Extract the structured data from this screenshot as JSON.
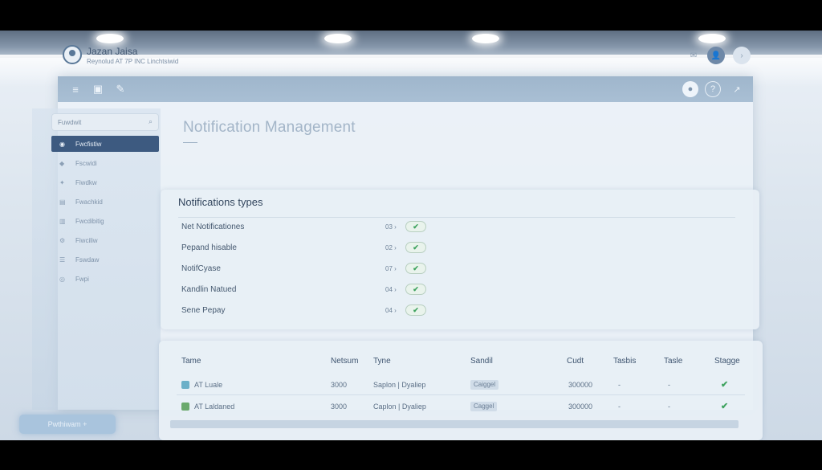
{
  "app": {
    "name": "Jazan Jaisa",
    "subtitle": "Reynolud AT 7P INC Linchtsiwid"
  },
  "top_icons": [
    "bell-icon",
    "avatar",
    "more-icon"
  ],
  "toolbar": {
    "left_icons": [
      "menu-icon",
      "lock-icon",
      "pen-icon"
    ],
    "right_icons": [
      "user-icon",
      "help-icon",
      "expand-icon"
    ]
  },
  "sidebar": {
    "search_placeholder": "Fuwdwit",
    "items": [
      {
        "label": "Fwcfistiw",
        "icon": "bell-icon",
        "active": true
      },
      {
        "label": "Fscwidi",
        "icon": "home-icon",
        "active": false
      },
      {
        "label": "Fiwdkw",
        "icon": "user-icon",
        "active": false
      },
      {
        "label": "Fwachkid",
        "icon": "chart-icon",
        "active": false
      },
      {
        "label": "Fwcdibitig",
        "icon": "file-icon",
        "active": false
      },
      {
        "label": "Fiwciliw",
        "icon": "gear-icon",
        "active": false
      },
      {
        "label": "Fswdaw",
        "icon": "list-icon",
        "active": false
      },
      {
        "label": "Fwpi",
        "icon": "help-icon",
        "active": false
      }
    ],
    "bottom_button": "Pwthiwam +"
  },
  "page": {
    "title": "Notification Management"
  },
  "notifications_card": {
    "title": "Notifications types",
    "rows": [
      {
        "label": "Net Notificationes",
        "count": "03 ›",
        "enabled": true
      },
      {
        "label": "Pepand hisable",
        "count": "02 ›",
        "enabled": true
      },
      {
        "label": "NotifCyase",
        "count": "07 ›",
        "enabled": true
      },
      {
        "label": "Kandlin Natued",
        "count": "04 ›",
        "enabled": true
      },
      {
        "label": "Sene Pepay",
        "count": "04 ›",
        "enabled": true
      }
    ]
  },
  "table": {
    "headers": [
      "Tame",
      "Netsum",
      "Tyne",
      "Sandil",
      "Cudt",
      "Tasbis",
      "Tasle",
      "Stagge"
    ],
    "rows": [
      {
        "name": "AT Luale",
        "netsum": "3000",
        "type": "Saplon | Dyaliep",
        "sandil": "Caiggel",
        "cudt": "300000",
        "tasbis": "-",
        "tasle": "-",
        "status": "✔",
        "icon_color": "#6cb0c8"
      },
      {
        "name": "AT Laldaned",
        "netsum": "3000",
        "type": "Caplon | Dyaliep",
        "sandil": "Caggel",
        "cudt": "300000",
        "tasbis": "-",
        "tasle": "-",
        "status": "✔",
        "icon_color": "#6aa96c"
      }
    ]
  },
  "colors": {
    "accent": "#3d5a80",
    "toggle_on": "#3fa35f",
    "toolbar": "#a4bad0"
  }
}
